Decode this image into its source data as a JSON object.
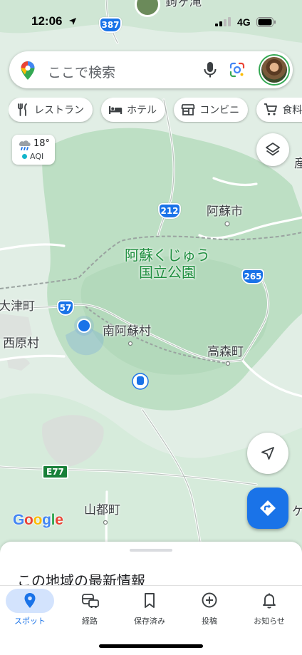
{
  "status_bar": {
    "time": "12:06",
    "network": "4G"
  },
  "search": {
    "placeholder": "ここで検索"
  },
  "chips": [
    {
      "label": "レストラン",
      "icon": "fork-knife-icon"
    },
    {
      "label": "ホテル",
      "icon": "bed-icon"
    },
    {
      "label": "コンビニ",
      "icon": "store-icon"
    },
    {
      "label": "食料品",
      "icon": "cart-icon"
    }
  ],
  "weather": {
    "temperature": "18°",
    "aqi_label": "AQI",
    "icon": "rain-cloud-icon",
    "aqi_color": "#12b5cb"
  },
  "map": {
    "places": {
      "aso_city": "阿蘇市",
      "park_line1": "阿蘇くじゅう",
      "park_line2": "国立公園",
      "minamiaso": "南阿蘇村",
      "otsu": "大津町",
      "nishihara": "西原村",
      "takamori": "高森町",
      "yamato": "山都町",
      "top_partial": "鉤ヶ滝",
      "right_partial": "産",
      "right_partial2": "ケ"
    },
    "routes": {
      "r387": "387",
      "r212": "212",
      "r265": "265",
      "r57": "57",
      "e77": "E77"
    },
    "colors": {
      "base": "#e3efe6",
      "forest": "#b9dcc1",
      "road": "#ffffff",
      "route_shield": "#1a73e8",
      "park_label": "#1e8e3e"
    }
  },
  "brand": {
    "g1": "G",
    "o1": "o",
    "o2": "o",
    "g2": "g",
    "l": "l",
    "e": "e"
  },
  "sheet": {
    "title": "この地域の最新情報"
  },
  "nav": [
    {
      "label": "スポット",
      "icon": "location-pin-icon",
      "active": true
    },
    {
      "label": "経路",
      "icon": "commute-icon",
      "active": false
    },
    {
      "label": "保存済み",
      "icon": "bookmark-icon",
      "active": false
    },
    {
      "label": "投稿",
      "icon": "add-circle-icon",
      "active": false
    },
    {
      "label": "お知らせ",
      "icon": "bell-icon",
      "active": false
    }
  ]
}
